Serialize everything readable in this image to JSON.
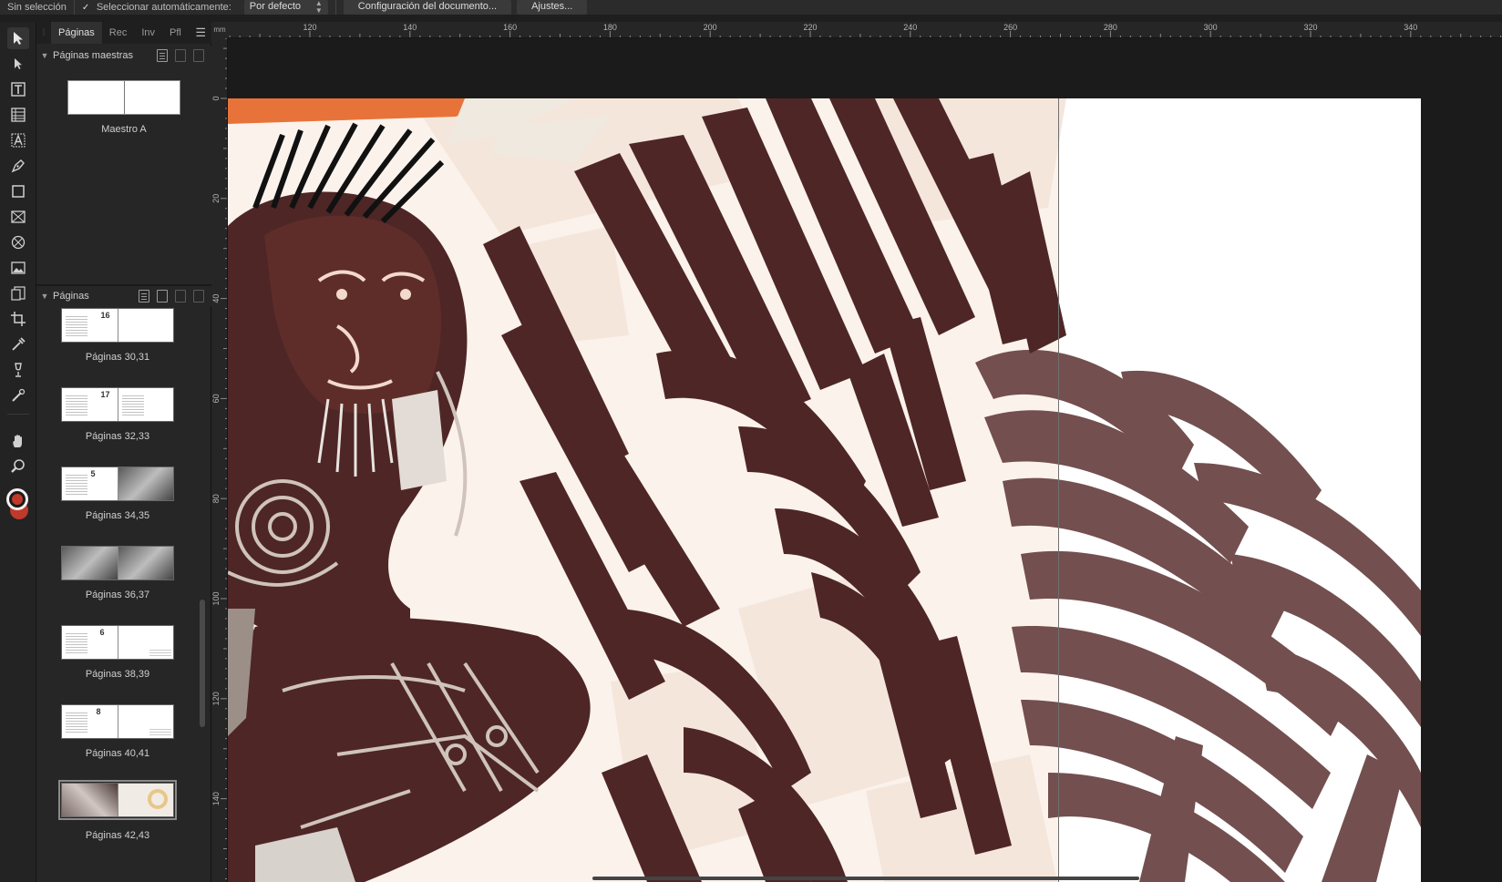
{
  "context_toolbar": {
    "selection_status": "Sin selección",
    "auto_select_label": "Seleccionar automáticamente:",
    "auto_select_value": "Por defecto",
    "doc_setup_button": "Configuración del documento...",
    "settings_button": "Ajustes..."
  },
  "tools": [
    "move-tool-icon",
    "node-tool-icon",
    "frame-text-tool-icon",
    "table-tool-icon",
    "artistic-text-tool-icon",
    "pen-tool-icon",
    "rectangle-tool-icon",
    "picture-frame-tool-icon",
    "ellipse-frame-tool-icon",
    "place-image-tool-icon",
    "place-tool-icon",
    "crop-tool-icon",
    "color-picker-tool-icon",
    "fill-tool-icon",
    "transparency-tool-icon",
    "hand-tool-icon",
    "zoom-tool-icon",
    "color-swatch-icon"
  ],
  "panel": {
    "tabs": [
      "Páginas",
      "Rec",
      "Inv",
      "Pfl"
    ],
    "active_tab": "Páginas",
    "master_section_title": "Páginas maestras",
    "master_label": "Maestro A",
    "pages_section_title": "Páginas",
    "spreads": [
      {
        "label": "Páginas 30,31",
        "page_number": "16"
      },
      {
        "label": "Páginas 32,33",
        "page_number": "17"
      },
      {
        "label": "Páginas 34,35",
        "page_number": "5"
      },
      {
        "label": "Páginas 36,37",
        "page_number": ""
      },
      {
        "label": "Páginas 38,39",
        "page_number": "6"
      },
      {
        "label": "Páginas 40,41",
        "page_number": "8"
      },
      {
        "label": "Páginas 42,43",
        "page_number": ""
      }
    ],
    "selected_spread": "Páginas 42,43"
  },
  "ruler": {
    "unit": "mm",
    "top_labels": [
      "120",
      "140",
      "160",
      "180",
      "200",
      "220",
      "240",
      "260",
      "280",
      "300",
      "320",
      "340"
    ],
    "left_labels": [
      "0",
      "20",
      "40",
      "60",
      "80",
      "100",
      "120",
      "140"
    ]
  },
  "colors": {
    "app_bg": "#1e1e1e",
    "panel_bg": "#262626",
    "artwork_dark_brown": "#4e2626",
    "artwork_mauve": "#734f4f",
    "artwork_cream": "#f5e6dc",
    "accent_orange": "#e8733a"
  }
}
